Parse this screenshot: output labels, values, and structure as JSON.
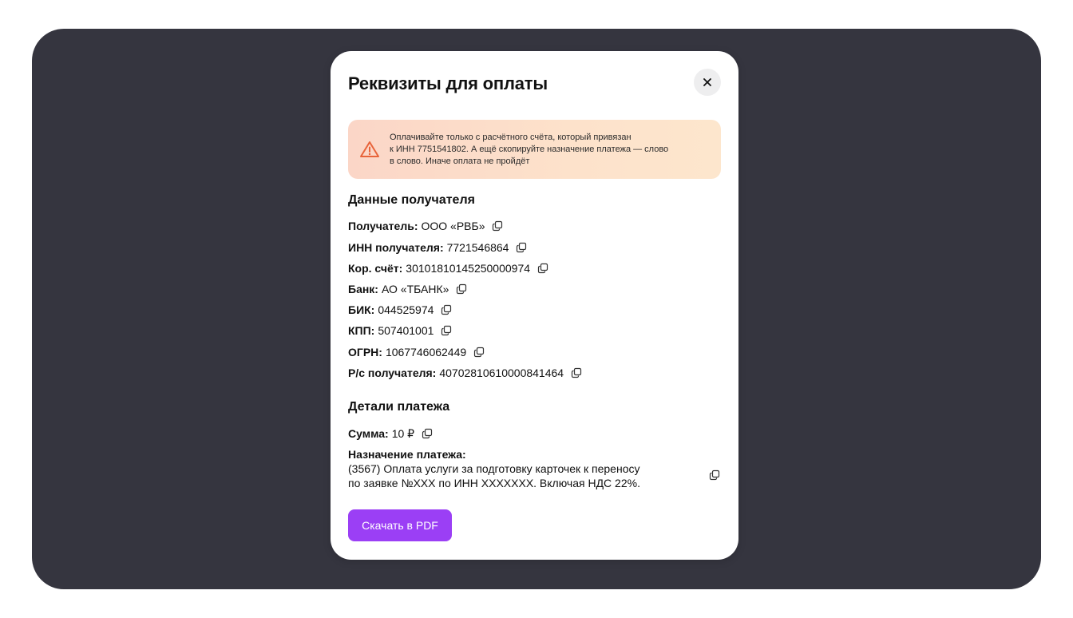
{
  "modal": {
    "title": "Реквизиты для оплаты",
    "close_icon": "close-icon"
  },
  "alert": {
    "icon": "warning-icon",
    "icon_color": "#e8643a",
    "line1": "Оплачивайте только с расчётного счёта, который привязан",
    "line2": "к ИНН 7751541802. А ещё скопируйте назначение платежа — слово",
    "line3": "в слово. Иначе оплата не пройдёт"
  },
  "recipient": {
    "title": "Данные получателя",
    "fields": [
      {
        "label": "Получатель:",
        "value": "ООО «РВБ»"
      },
      {
        "label": "ИНН получателя:",
        "value": "7721546864"
      },
      {
        "label": "Кор. счёт:",
        "value": "30101810145250000974"
      },
      {
        "label": "Банк:",
        "value": "АО «ТБАНК»"
      },
      {
        "label": "БИК:",
        "value": "044525974"
      },
      {
        "label": "КПП:",
        "value": "507401001"
      },
      {
        "label": "ОГРН:",
        "value": "1067746062449"
      },
      {
        "label": "Р/с получателя:",
        "value": "40702810610000841464"
      }
    ]
  },
  "payment": {
    "title": "Детали платежа",
    "amount_label": "Сумма:",
    "amount_value": "10 ₽",
    "purpose_label": "Назначение платежа:",
    "purpose_line1": "(3567) Оплата услуги за подготовку карточек к переносу",
    "purpose_line2": "по заявке №XXX по ИНН XXXXXXX. Включая НДС 22%."
  },
  "actions": {
    "download_pdf": "Скачать в PDF"
  },
  "colors": {
    "backdrop": "#35353f",
    "accent": "#9b3ff5",
    "alert_bg": "#fcdcc9"
  }
}
